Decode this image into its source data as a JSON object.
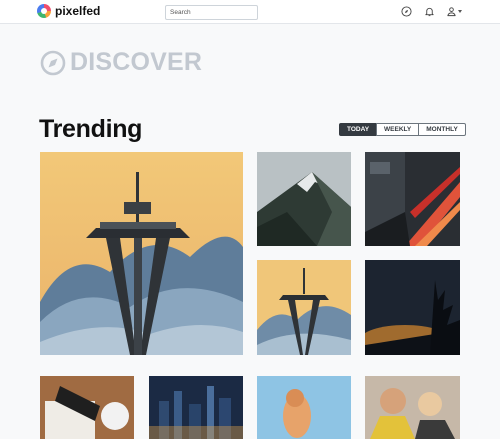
{
  "app": {
    "name": "pixelfed"
  },
  "search": {
    "placeholder": "Search"
  },
  "nav_icons": [
    "compass-icon",
    "bell-icon",
    "user-icon"
  ],
  "discover": {
    "title": "DISCOVER"
  },
  "trending": {
    "title": "Trending",
    "filters": [
      {
        "label": "TODAY",
        "active": true
      },
      {
        "label": "WEEKLY",
        "active": false
      },
      {
        "label": "MONTHLY",
        "active": false
      }
    ]
  },
  "colors": {
    "accent": "#343a40",
    "muted_heading": "#c2c8d0",
    "background": "#f8f9fa"
  }
}
